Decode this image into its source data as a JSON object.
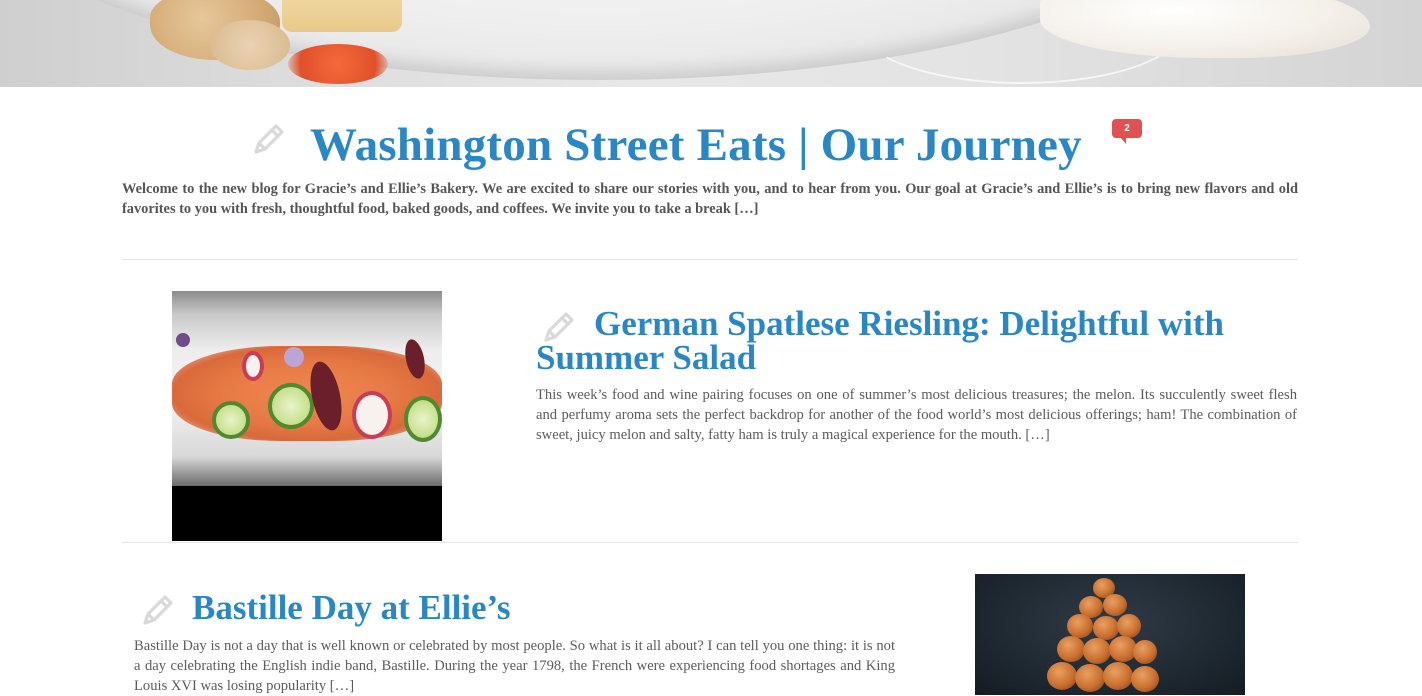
{
  "header": {
    "hero_image": "dessert-plate-banner"
  },
  "posts": [
    {
      "title": "Washington Street Eats | Our Journey",
      "comment_count": "2",
      "excerpt": "Welcome to the new blog for Gracie’s and Ellie’s Bakery. We are excited to share our stories with you, and to hear from you. Our goal at Gracie’s and Ellie’s is to bring new flavors and old favorites to you with fresh, thoughtful food, baked goods, and coffees. We invite you to take a break […]",
      "icon": "pencil-icon"
    },
    {
      "title": "German Spatlese Riesling: Delightful with Summer Salad",
      "excerpt": "This week’s food and wine pairing focuses on one of summer’s most delicious treasures; the melon. Its succulently sweet flesh and perfumy aroma sets the perfect backdrop for another of the food world’s most delicious offerings; ham! The combination of sweet, juicy melon and salty, fatty ham is truly a magical experience for the mouth. […]",
      "icon": "pencil-icon",
      "thumbnail": "salmon-salad-photo"
    },
    {
      "title": "Bastille Day at Ellie’s",
      "excerpt": "Bastille Day is not a day that is well known or celebrated by most people.  So what is it all about? I can tell you one thing: it is not a day celebrating the English indie band, Bastille.  During the year 1798, the French were experiencing food shortages and King Louis XVI was losing popularity […]",
      "icon": "pencil-icon",
      "thumbnail": "croquembouche-photo"
    }
  ],
  "colors": {
    "title": "#2a87c6",
    "badge": "#e05252",
    "text": "#5b5b5b",
    "pencil": "#d9d9d9"
  }
}
